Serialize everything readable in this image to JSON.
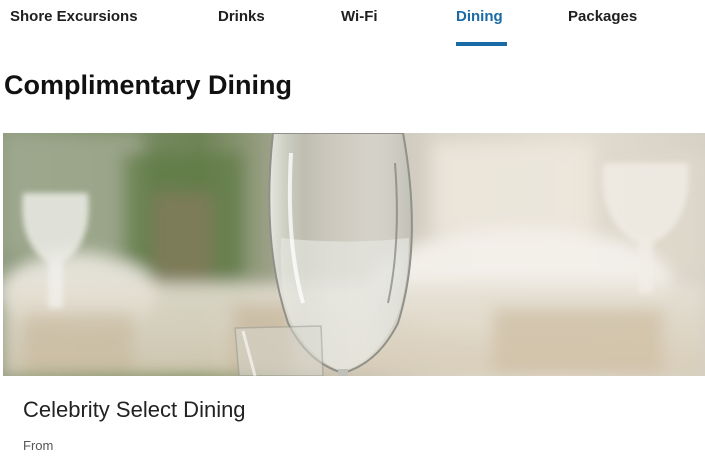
{
  "tabs": [
    {
      "label": "Shore Excursions",
      "active": false
    },
    {
      "label": "Drinks",
      "active": false
    },
    {
      "label": "Wi-Fi",
      "active": false
    },
    {
      "label": "Dining",
      "active": true
    },
    {
      "label": "Packages",
      "active": false
    }
  ],
  "section": {
    "title": "Complimentary Dining"
  },
  "card": {
    "image_icon": "wine-glass-photo",
    "title": "Celebrity Select Dining",
    "from_label": "From"
  },
  "colors": {
    "accent": "#1a6aa6",
    "text": "#1b1b1b"
  }
}
